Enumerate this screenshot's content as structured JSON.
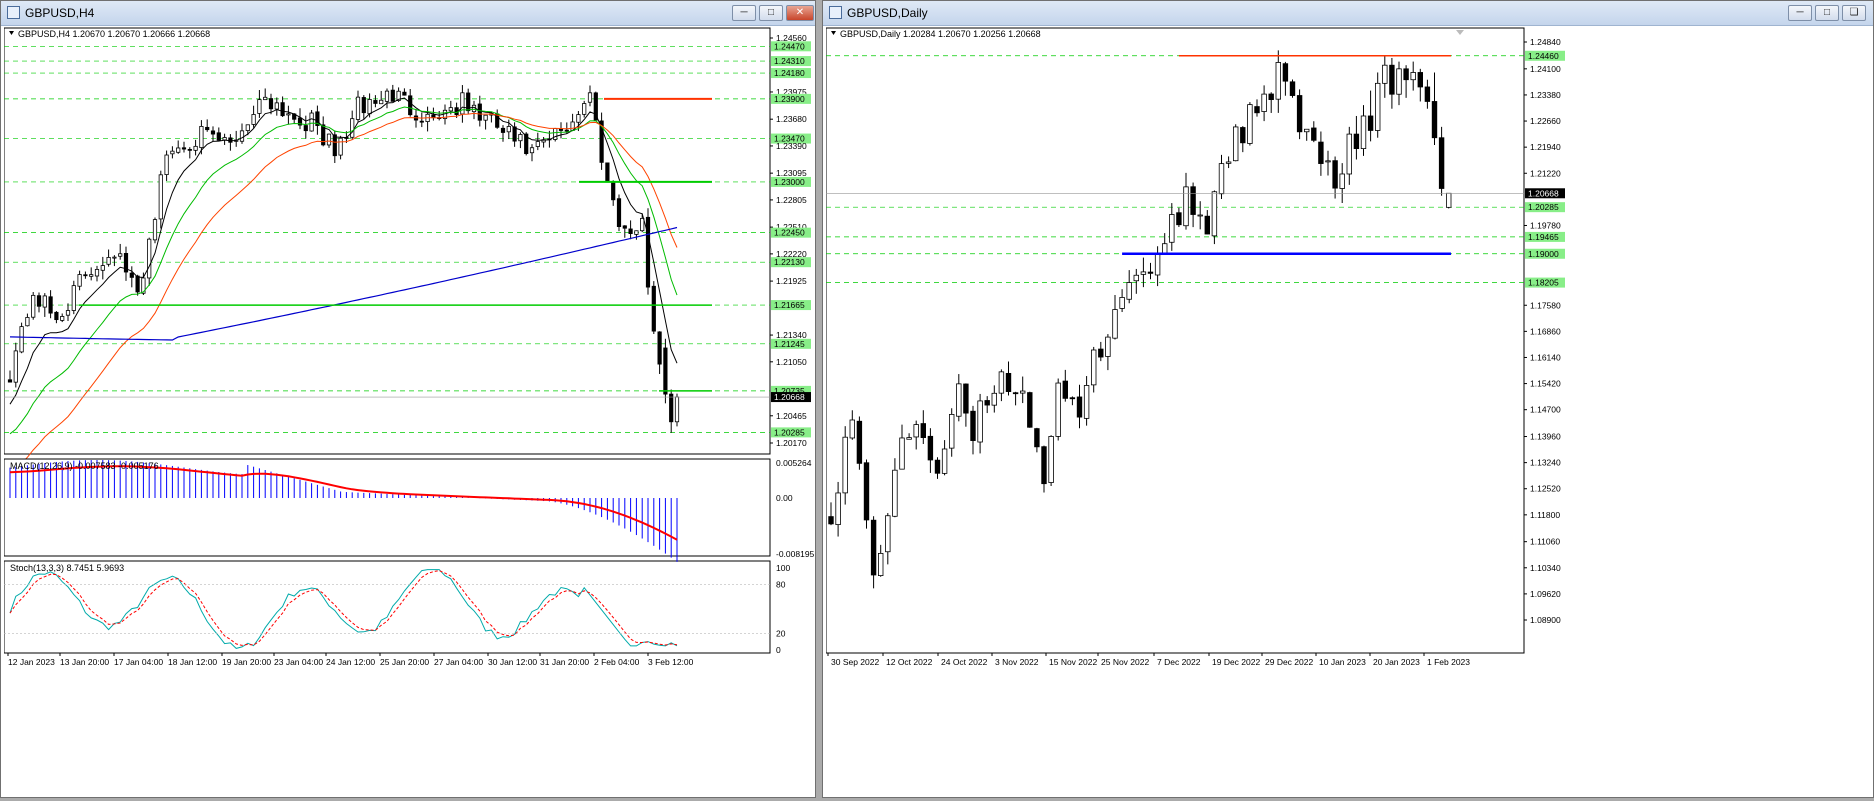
{
  "left_window": {
    "title": "GBPUSD,H4",
    "header": "GBPUSD,H4  1.20670 1.20670 1.20666 1.20668",
    "price_axis": [
      "1.24560",
      "1.24470",
      "1.24310",
      "1.24180",
      "1.23975",
      "1.23900",
      "1.23680",
      "1.23470",
      "1.23390",
      "1.23095",
      "1.23000",
      "1.22805",
      "1.22510",
      "1.22450",
      "1.22220",
      "1.22130",
      "1.21925",
      "1.21665",
      "1.21340",
      "1.21245",
      "1.21050",
      "1.20735",
      "1.20668",
      "1.20465",
      "1.20285",
      "1.20170"
    ],
    "macd_label": "MACD(12,26,9) -0.007583 -0.005176",
    "macd_axis": [
      "0.005264",
      "0.00",
      "-0.008195"
    ],
    "stoch_label": "Stoch(13,3,3) 8.7451 5.9693",
    "stoch_axis": [
      "100",
      "80",
      "20",
      "0"
    ],
    "time_axis": [
      "12 Jan 2023",
      "13 Jan 20:00",
      "17 Jan 04:00",
      "18 Jan 12:00",
      "19 Jan 20:00",
      "23 Jan 04:00",
      "24 Jan 12:00",
      "25 Jan 20:00",
      "27 Jan 04:00",
      "30 Jan 12:00",
      "31 Jan 20:00",
      "2 Feb 04:00",
      "3 Feb 12:00"
    ]
  },
  "right_window": {
    "title": "GBPUSD,Daily",
    "header": "GBPUSD,Daily  1.20284 1.20670 1.20256 1.20668",
    "price_axis": [
      "1.24840",
      "1.24460",
      "1.24100",
      "1.23380",
      "1.22660",
      "1.21940",
      "1.21220",
      "1.20668",
      "1.20285",
      "1.19780",
      "1.19465",
      "1.19000",
      "1.18205",
      "1.17580",
      "1.16860",
      "1.16140",
      "1.15420",
      "1.14700",
      "1.13960",
      "1.13240",
      "1.12520",
      "1.11800",
      "1.11060",
      "1.10340",
      "1.09620",
      "1.08900"
    ],
    "time_axis": [
      "30 Sep 2022",
      "12 Oct 2022",
      "24 Oct 2022",
      "3 Nov 2022",
      "15 Nov 2022",
      "25 Nov 2022",
      "7 Dec 2022",
      "19 Dec 2022",
      "29 Dec 2022",
      "10 Jan 2023",
      "20 Jan 2023",
      "1 Feb 2023"
    ]
  },
  "colors": {
    "bull_candle": "#ffffff",
    "bear_candle": "#000000",
    "level_red": "#ff3300",
    "level_green": "#00cc00",
    "level_blue": "#0000ff",
    "ma_black": "#000000",
    "ma_green": "#00bb00",
    "ma_orange": "#ff4400",
    "ma_blue": "#0000cc",
    "grid_green": "#00cc00",
    "macd_hist": "#0000ff",
    "macd_signal": "#ff0000",
    "stoch_main": "#00aaaa",
    "stoch_signal": "#ff0000",
    "current_price_box": "#000000",
    "level_label_box": "#88ee88"
  }
}
